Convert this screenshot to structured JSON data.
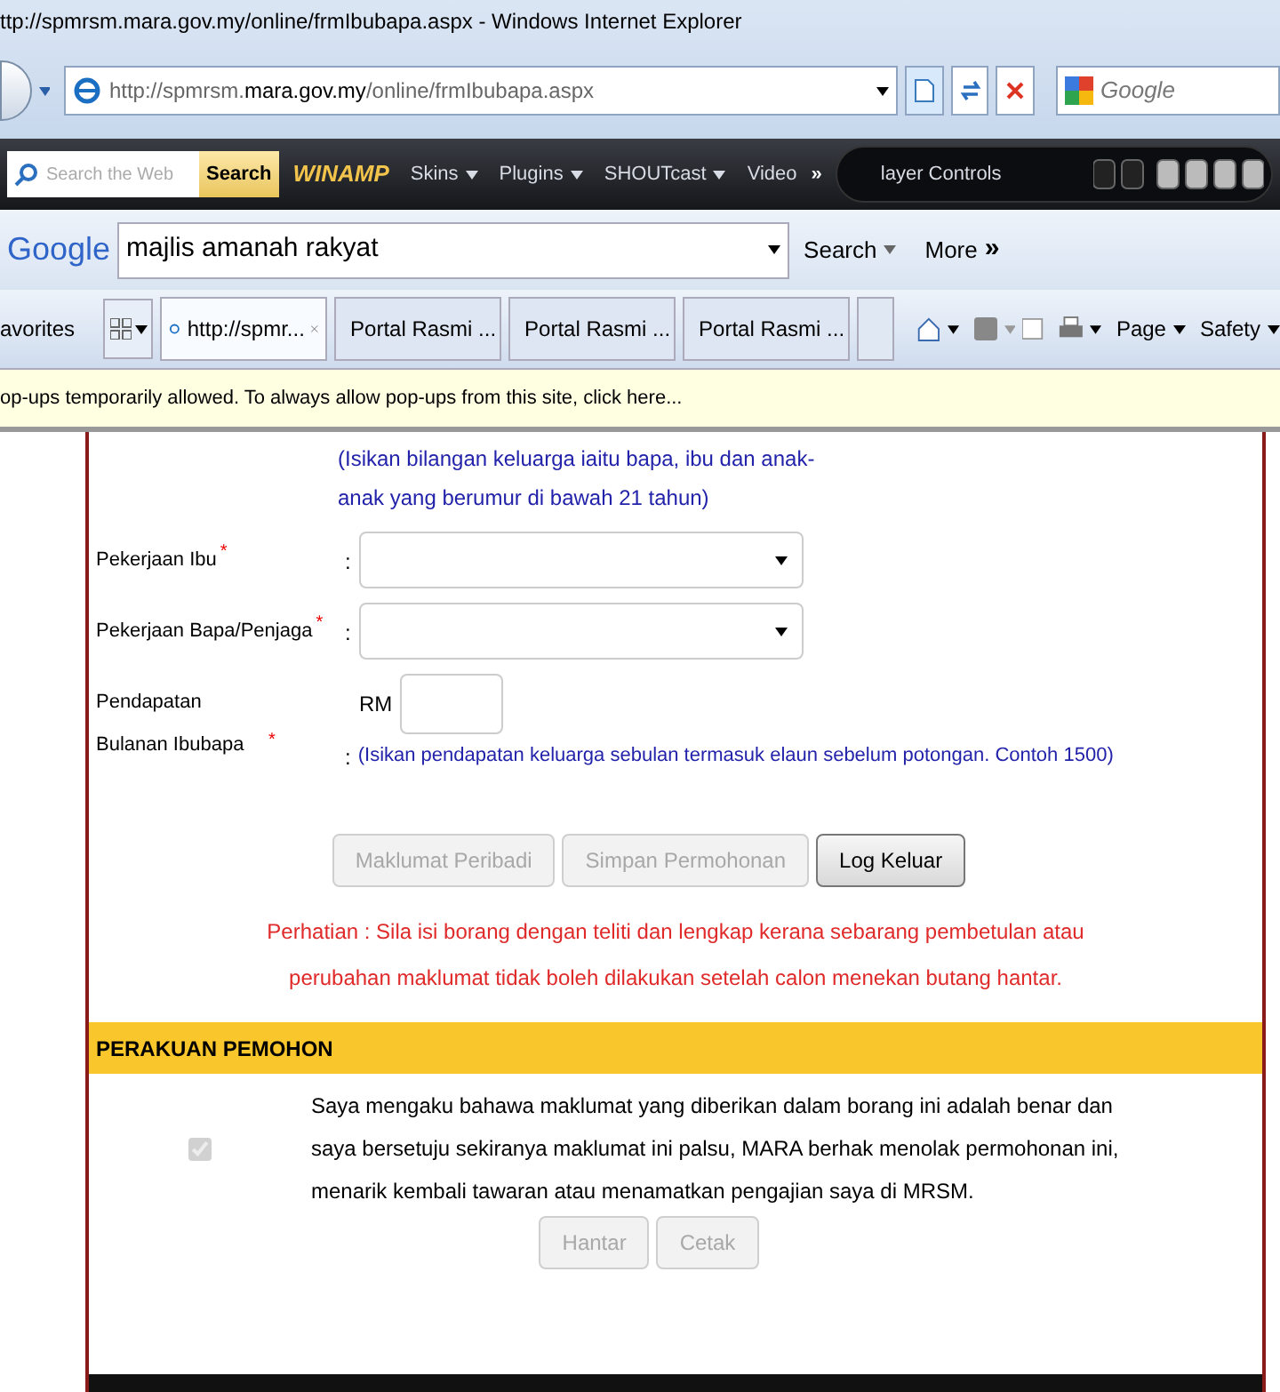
{
  "window": {
    "title": "ttp://spmrsm.mara.gov.my/online/frmIbubapa.aspx - Windows Internet Explorer"
  },
  "address_bar": {
    "url": "http://spmrsm.**mara.gov.my**/online/frmIbubapa.aspx",
    "search_placeholder": "Google"
  },
  "winamp_toolbar": {
    "search_placeholder": "Search the Web",
    "search_button": "Search",
    "brand": "WINAMP",
    "menus": [
      "Skins",
      "Plugins",
      "SHOUTcast",
      "Video"
    ],
    "overflow": "»",
    "player_label": "layer Controls"
  },
  "google_toolbar": {
    "logo": "Google",
    "query": "majlis amanah rakyat",
    "search_button": "Search",
    "more": "More",
    "more_arrows": "»"
  },
  "tab_bar": {
    "favorites": "avorites",
    "tabs": [
      {
        "label": "http://spmr...",
        "selected": true
      },
      {
        "label": "Portal Rasmi ...",
        "selected": false
      },
      {
        "label": "Portal Rasmi ...",
        "selected": false
      },
      {
        "label": "Portal Rasmi ...",
        "selected": false
      }
    ],
    "commands": [
      "Page",
      "Safety"
    ]
  },
  "info_bar": {
    "text": "op-ups temporarily allowed. To always allow pop-ups from this site, click here..."
  },
  "form": {
    "family_hint": "(Isikan bilangan keluarga iaitu bapa, ibu dan anak-anak yang berumur di bawah 21 tahun)",
    "required_mark": "*",
    "fields": [
      {
        "kind": "select",
        "label": "Pekerjaan Ibu",
        "required": true,
        "separator": ":"
      },
      {
        "kind": "select",
        "label": "Pekerjaan Bapa/Penjaga",
        "required": true,
        "separator": ":"
      },
      {
        "kind": "money",
        "label": "Pendapatan Bulanan Ibubapa",
        "required": true,
        "separator": ":",
        "prefix": "RM",
        "hint": "(Isikan pendapatan keluarga sebulan termasuk elaun sebelum potongan. Contoh 1500)"
      }
    ],
    "buttons": [
      {
        "label": "Maklumat Peribadi",
        "disabled": true
      },
      {
        "label": "Simpan Permohonan",
        "disabled": true
      },
      {
        "label": "Log Keluar",
        "disabled": false
      }
    ],
    "warning": "Perhatian : Sila isi borang dengan teliti dan lengkap kerana sebarang pembetulan atau perubahan maklumat tidak boleh dilakukan setelah calon menekan butang hantar."
  },
  "declaration": {
    "header": "PERAKUAN PEMOHON",
    "checked": true,
    "disabled": true,
    "text": "Saya mengaku bahawa maklumat yang diberikan dalam borang ini adalah benar dan saya bersetuju sekiranya maklumat ini palsu, MARA berhak menolak permohonan ini, menarik kembali tawaran atau menamatkan pengajian saya di MRSM.",
    "buttons": [
      {
        "label": "Hantar",
        "disabled": true
      },
      {
        "label": "Cetak",
        "disabled": true
      }
    ]
  }
}
